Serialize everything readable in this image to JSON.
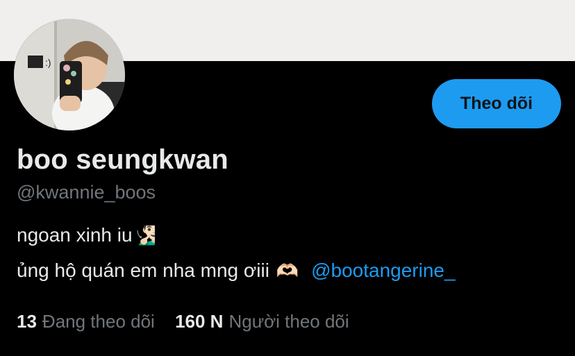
{
  "profile": {
    "display_name": "boo seungkwan",
    "handle": "@kwannie_boos",
    "avatar_icon": "profile-photo",
    "colors": {
      "banner": "#f0efed",
      "accent": "#1d9bf0",
      "muted": "#71767b"
    }
  },
  "actions": {
    "follow_label": "Theo dõi"
  },
  "bio": {
    "line1_text": "ngoan xinh iu",
    "line1_emoji": "🧏🏻‍♂️",
    "line2_text": "ủng hộ quán em nha mng ơiii",
    "line2_emoji": "🫶🏻",
    "mention": "@bootangerine_"
  },
  "stats": {
    "following_count": "13",
    "following_label": "Đang theo dõi",
    "followers_count": "160 N",
    "followers_label": "Người theo dõi"
  }
}
